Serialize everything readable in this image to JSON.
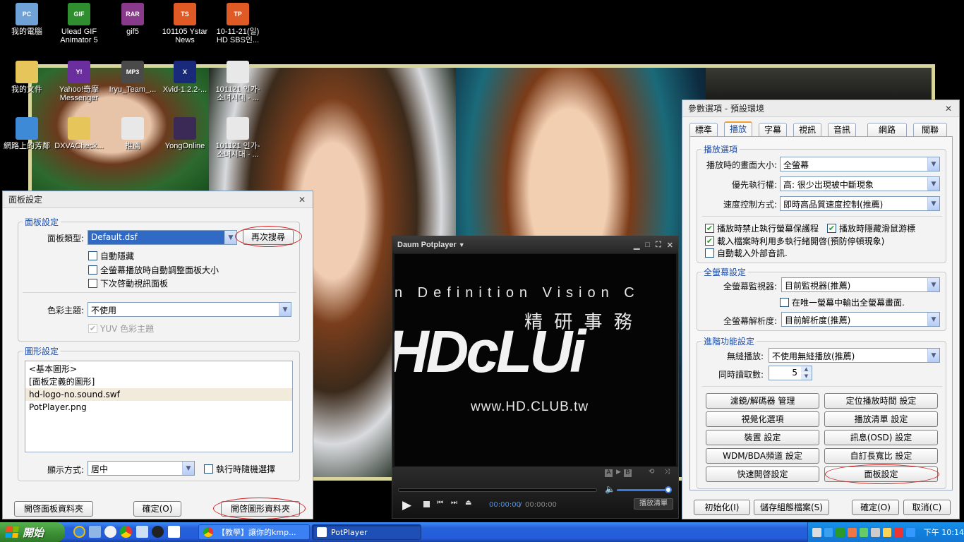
{
  "desktop": {
    "icons": [
      {
        "label": "我的電腦",
        "color": "#6fa2d6",
        "glyph": "PC"
      },
      {
        "label": "Ulead GIF Animator 5",
        "color": "#2f8f2f",
        "glyph": "GIF"
      },
      {
        "label": "gif5",
        "color": "#8a3a8a",
        "glyph": "RAR"
      },
      {
        "label": "101105 Ystar News",
        "color": "#e05a25",
        "glyph": "TS"
      },
      {
        "label": "10-11-21(일) HD SBS인...",
        "color": "#e05a25",
        "glyph": "TP"
      },
      {
        "label": "我的文件",
        "color": "#e6c65a",
        "glyph": ""
      },
      {
        "label": "Yahoo!奇摩 Messenger",
        "color": "#6b2e9e",
        "glyph": "Y!"
      },
      {
        "label": "Iryu_Team_...",
        "color": "#4a4a4a",
        "glyph": "MP3"
      },
      {
        "label": "Xvid-1.2.2-...",
        "color": "#1a2a7a",
        "glyph": "X"
      },
      {
        "label": "101121 인가- 소녀시대 - ...",
        "color": "#e8e8e8",
        "glyph": ""
      },
      {
        "label": "網路上的芳鄰",
        "color": "#3f8ad6",
        "glyph": ""
      },
      {
        "label": "DXVACheck...",
        "color": "#e6c65a",
        "glyph": ""
      },
      {
        "label": "推薦",
        "color": "#e8e8e8",
        "glyph": ""
      },
      {
        "label": "YongOnline",
        "color": "#3b2a55",
        "glyph": ""
      },
      {
        "label": "101121 인가- 소녀시대 - ...",
        "color": "#e8e8e8",
        "glyph": ""
      }
    ]
  },
  "panel_dialog": {
    "title": "面板設定",
    "group_panel": {
      "legend": "面板設定",
      "type_label": "面板類型:",
      "type_value": "Default.dsf",
      "research_button": "再次搜尋",
      "auto_hide": "自動隱藏",
      "auto_resize": "全螢幕播放時自動調整面板大小",
      "next_video_panel": "下次啓動視訊面板",
      "color_theme_label": "色彩主題:",
      "color_theme_value": "不使用",
      "yuv_theme": "YUV 色彩主題"
    },
    "group_graphics": {
      "legend": "圖形設定",
      "items": [
        "<基本圖形>",
        "[面板定義的圖形]",
        "hd-logo-no.sound.swf",
        "PotPlayer.png"
      ],
      "display_label": "顯示方式:",
      "display_value": "居中",
      "random_select": "執行時隨機選擇"
    },
    "buttons": {
      "open_panel_folder": "開啓面板資料夾",
      "ok": "確定(O)",
      "open_graphics_folder": "開啓圖形資料夾"
    }
  },
  "potplayer": {
    "title": "Daum Potplayer",
    "screen_line1": "n Definition Vision C",
    "screen_chinese": "精 研 事 務",
    "screen_logo": "HDcLUi",
    "screen_url": "www.HD.CLUB.tw",
    "time_current": "00:00:00",
    "time_total": "00:00:00",
    "playlist_button": "播放清單",
    "ab_a": "A",
    "ab_b": "B"
  },
  "prefs_dialog": {
    "title": "參數選項 - 預設環境",
    "tabs": [
      "標準",
      "播放",
      "字幕",
      "視訊",
      "音訊",
      "網路",
      "關聯"
    ],
    "active_tab": "播放",
    "playback": {
      "legend": "播放選項",
      "screen_size_label": "播放時的畫面大小:",
      "screen_size_value": "全螢幕",
      "priority_label": "優先執行權:",
      "priority_value": "高: 很少出現被中斷現象",
      "speed_label": "速度控制方式:",
      "speed_value": "即時高品質速度控制(推薦)",
      "chk_screensaver": "播放時禁止執行螢幕保護程",
      "chk_hide_cursor": "播放時隱藏滑鼠游標",
      "chk_multithread": "載入檔案時利用多執行緒開啓(預防停頓現象)",
      "chk_external_audio": "自動載入外部音訊."
    },
    "fullscreen": {
      "legend": "全螢幕設定",
      "monitor_label": "全螢幕監視器:",
      "monitor_value": "目前監視器(推薦)",
      "single_monitor_output": "在唯一螢幕中輸出全螢幕畫面.",
      "resolution_label": "全螢幕解析度:",
      "resolution_value": "目前解析度(推薦)"
    },
    "advanced": {
      "legend": "進階功能設定",
      "seamless_label": "無縫播放:",
      "seamless_value": "不使用無縫播放(推薦)",
      "read_count_label": "同時讀取數:",
      "read_count_value": "5"
    },
    "feature_buttons": [
      "濾鏡/解碼器 管理",
      "定位播放時間 設定",
      "視覺化選項",
      "播放清單 設定",
      "裝置 設定",
      "訊息(OSD) 設定",
      "WDM/BDA頻道 設定",
      "自訂長寬比 設定",
      "快速開啓設定",
      "面板設定"
    ],
    "bottom_buttons": {
      "init": "初始化(I)",
      "save_profile": "儲存組態檔案(S)",
      "ok": "確定(O)",
      "cancel": "取消(C)"
    }
  },
  "taskbar": {
    "start_label": "開始",
    "tasks": [
      {
        "label": "【教學】讓你的kmp..."
      },
      {
        "label": "PotPlayer"
      }
    ],
    "clock": "下午 10:14"
  },
  "colors": {
    "annotation_ring": "#d32222",
    "accent_blue": "#1e4ea8",
    "taskbar_blue": "#245ddb"
  }
}
